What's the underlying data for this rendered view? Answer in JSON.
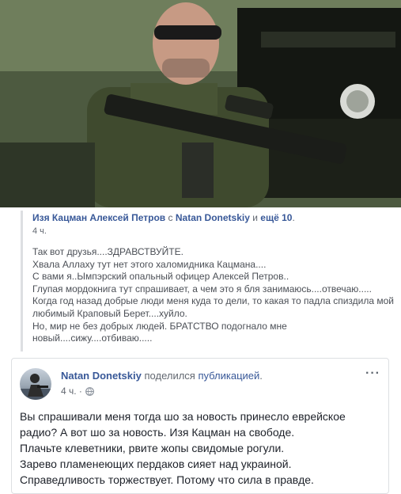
{
  "shared_post": {
    "author": "Изя Кацман Алексей Петров",
    "with_word": "с",
    "tagged": "Natan Donetskiy",
    "and_word": "и",
    "others": "ещё 10",
    "period": ".",
    "time": "4 ч.",
    "lines": [
      "Так вот друзья....ЗДРАВСТВУЙТЕ.",
      "Хвала Аллаху тут нет этого халомидника Кацмана....",
      "С вами я..Ымпэрский опальный офицер Алексей Петров..",
      "Глупая мордокнига тут спрашивает, а чем это я бля занимаюсь....отвечаю.....",
      "Когда год назад добрые люди меня куда то дели, то какая то падла спиздила мой",
      "любимый Краповый Берет....хуйло.",
      "Но, мир не без добрых людей. БРАТСТВО подогнало мне",
      "новый....сижу....отбиваю....."
    ]
  },
  "post": {
    "author": "Natan Donetskiy",
    "action": "поделился",
    "object": "публикацией",
    "period": ".",
    "time": "4 ч. ·",
    "more_label": "···",
    "lines": [
      "Вы спрашивали меня тогда шо за новость принесло еврейское",
      "радио? А вот шо за новость. Изя Кацман на свободе.",
      "Плачьте клеветники, рвите жопы свидомые рогули.",
      "Зарево пламенеющих пердаков сияет над украиной.",
      "Справедливость торжествует. Потому что сила в правде."
    ]
  },
  "colors": {
    "link": "#385898",
    "muted": "#616770",
    "border": "#dddfe2"
  },
  "icons": [
    "globe-icon",
    "more-options-icon"
  ]
}
